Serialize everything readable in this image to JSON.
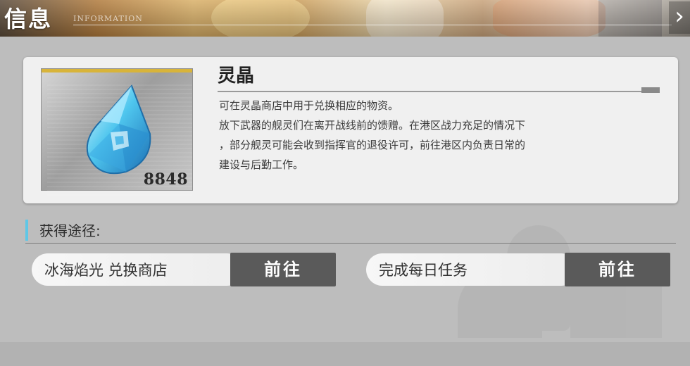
{
  "header": {
    "title": "信息",
    "subtitle": "INFORMATION",
    "close_glyph": "›"
  },
  "item": {
    "name": "灵晶",
    "count": "8848",
    "icon": "crystal-icon",
    "description": "可在灵晶商店中用于兑换相应的物资。\n放下武器的舰灵们在离开战线前的馈赠。在港区战力充足的情况下\n，部分舰灵可能会收到指挥官的退役许可，前往港区内负责日常的\n建设与后勤工作。"
  },
  "acquisition": {
    "label": "获得途径:",
    "routes": [
      {
        "label": "冰海焰光 兑换商店",
        "button": "前往"
      },
      {
        "label": "完成每日任务",
        "button": "前往"
      }
    ]
  },
  "colors": {
    "accent": "#5fc7e6",
    "rarity_bar": "#d8b43a",
    "button": "#5a5a5a",
    "card": "#f0f0f0"
  }
}
